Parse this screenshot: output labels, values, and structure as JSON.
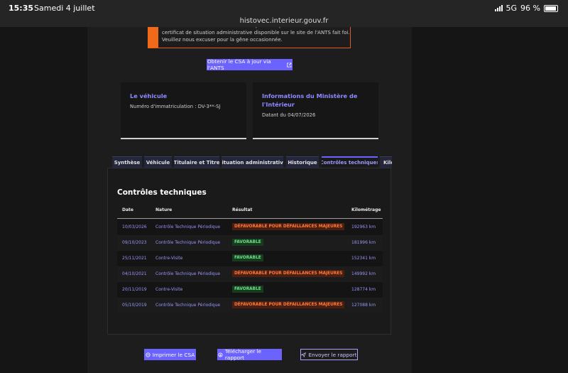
{
  "status_bar": {
    "time": "15:35",
    "date": "Samedi 4 juillet",
    "network": "5G",
    "battery": "96 %"
  },
  "browser": {
    "url": "histovec.interieur.gouv.fr"
  },
  "alert": {
    "text": "des données relatives aux véhicules qu'il vous permet de consulter. Seul le certificat de situation administrative disponible sur le site de l'ANTS fait foi. Veuillez nous excuser pour la gêne occasionnée."
  },
  "csa_button": {
    "label": "Obtenir le CSA à jour via l'ANTS",
    "icon": "external-link-icon"
  },
  "cards": {
    "vehicle": {
      "title": "Le véhicule",
      "plate_label": "Numéro d'immatriculation : DV-3**-SJ"
    },
    "ministry": {
      "title_line1": "Informations du Ministère de",
      "title_line2": "l'Intérieur",
      "date_label": "Datant du 04/07/2026"
    }
  },
  "tabs": [
    "Synthèse",
    "Véhicule",
    "Titulaire et Titre",
    "Situation administrative",
    "Historique",
    "Contrôles techniques",
    "Kilo"
  ],
  "active_tab": 5,
  "section": {
    "title": "Contrôles techniques",
    "headers": {
      "date": "Date",
      "nature": "Nature",
      "result": "Résultat",
      "km": "Kilométrage"
    },
    "rows": [
      {
        "date": "10/03/2026",
        "nature": "Contrôle Technique Périodique",
        "result": "DÉFAVORABLE POUR DÉFAILLANCES MAJEURES",
        "km": "192963 km"
      },
      {
        "date": "09/10/2023",
        "nature": "Contrôle Technique Périodique",
        "result": "FAVORABLE",
        "km": "181996 km"
      },
      {
        "date": "25/11/2021",
        "nature": "Contre-Visite",
        "result": "FAVORABLE",
        "km": "152341 km"
      },
      {
        "date": "04/10/2021",
        "nature": "Contrôle Technique Périodique",
        "result": "DÉFAVORABLE POUR DÉFAILLANCES MAJEURES",
        "km": "149992 km"
      },
      {
        "date": "20/11/2019",
        "nature": "Contre-Visite",
        "result": "FAVORABLE",
        "km": "128774 km"
      },
      {
        "date": "05/10/2019",
        "nature": "Contrôle Technique Périodique",
        "result": "DÉFAVORABLE POUR DÉFAILLANCES MAJEURES",
        "km": "127088 km"
      }
    ]
  },
  "actions": {
    "print": {
      "label": "Imprimer le CSA",
      "icon": "print-icon"
    },
    "download": {
      "label": "Télécharger le rapport",
      "icon": "download-icon"
    },
    "send": {
      "label": "Envoyer le rapport",
      "icon": "send-icon"
    }
  },
  "colors": {
    "accent": "#6c63ff",
    "favorable": "#6fe08a",
    "defavorable": "#ff7a3d",
    "alert": "#f06a1a"
  }
}
